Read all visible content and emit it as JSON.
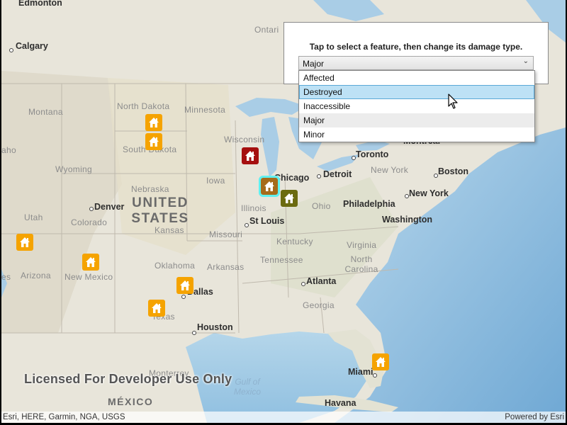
{
  "panel": {
    "instruction": "Tap to select a feature, then change its damage type.",
    "selected_value": "Major",
    "options": [
      "Affected",
      "Destroyed",
      "Inaccessible",
      "Major",
      "Minor"
    ],
    "hovered_option": "Destroyed"
  },
  "map": {
    "watermark": "Licensed For Developer Use Only",
    "attribution": "Esri, HERE, Garmin, NGA, USGS",
    "powered_by": "Powered by Esri",
    "labels": {
      "edmonton": "Edmonton",
      "calgary": "Calgary",
      "ontario": "Ontari",
      "montreal": "Montreal",
      "toronto": "Toronto",
      "detroit": "Detroit",
      "chicago": "Chicago",
      "new_york_state": "New York",
      "boston": "Boston",
      "new_york_city": "New York",
      "philadelphia": "Philadelphia",
      "washington": "Washington",
      "north_dakota": "North Dakota",
      "south_dakota": "South Dakota",
      "minnesota": "Minnesota",
      "wisconsin": "Wisconsin",
      "montana": "Montana",
      "idaho": "aho",
      "wyoming": "Wyoming",
      "nebraska": "Nebraska",
      "iowa": "Iowa",
      "illinois": "Illinois",
      "ohio": "Ohio",
      "utah": "Utah",
      "colorado": "Colorado",
      "denver": "Denver",
      "kansas": "Kansas",
      "missouri": "Missouri",
      "st_louis": "St Louis",
      "kentucky": "Kentucky",
      "virginia": "Virginia",
      "north_carolina": "North Carolina",
      "tennessee": "Tennessee",
      "oklahoma": "Oklahoma",
      "arkansas": "Arkansas",
      "arizona": "Arizona",
      "new_mexico": "New Mexico",
      "texas": "Texas",
      "dallas": "Dallas",
      "atlanta": "Atlanta",
      "georgia": "Georgia",
      "houston": "Houston",
      "monterrey": "Monterrey",
      "mexico": "MÉXICO",
      "gulf_of_mexico": "Gulf of Mexico",
      "miami": "Miami",
      "havana": "Havana",
      "united_states": "UNITED STATES",
      "es": "es"
    }
  },
  "markers": [
    {
      "id": "nd-1",
      "damage": "Minor"
    },
    {
      "id": "nd-2",
      "damage": "Minor"
    },
    {
      "id": "wi",
      "damage": "Destroyed"
    },
    {
      "id": "il",
      "damage": "Major",
      "selected": true
    },
    {
      "id": "in",
      "damage": "Affected"
    },
    {
      "id": "ut",
      "damage": "Minor"
    },
    {
      "id": "nm",
      "damage": "Minor"
    },
    {
      "id": "ok",
      "damage": "Minor"
    },
    {
      "id": "tx",
      "damage": "Minor"
    },
    {
      "id": "fl",
      "damage": "Minor"
    }
  ],
  "colors": {
    "Minor": "#f5a300",
    "Major": "#a56b1b",
    "Destroyed": "#a50f0f",
    "Affected": "#6b6b10",
    "selection": "#5ff0f0",
    "land": "#e9e6dc",
    "water": "#a9cde6",
    "ocean_deep": "#7fb2d8"
  }
}
